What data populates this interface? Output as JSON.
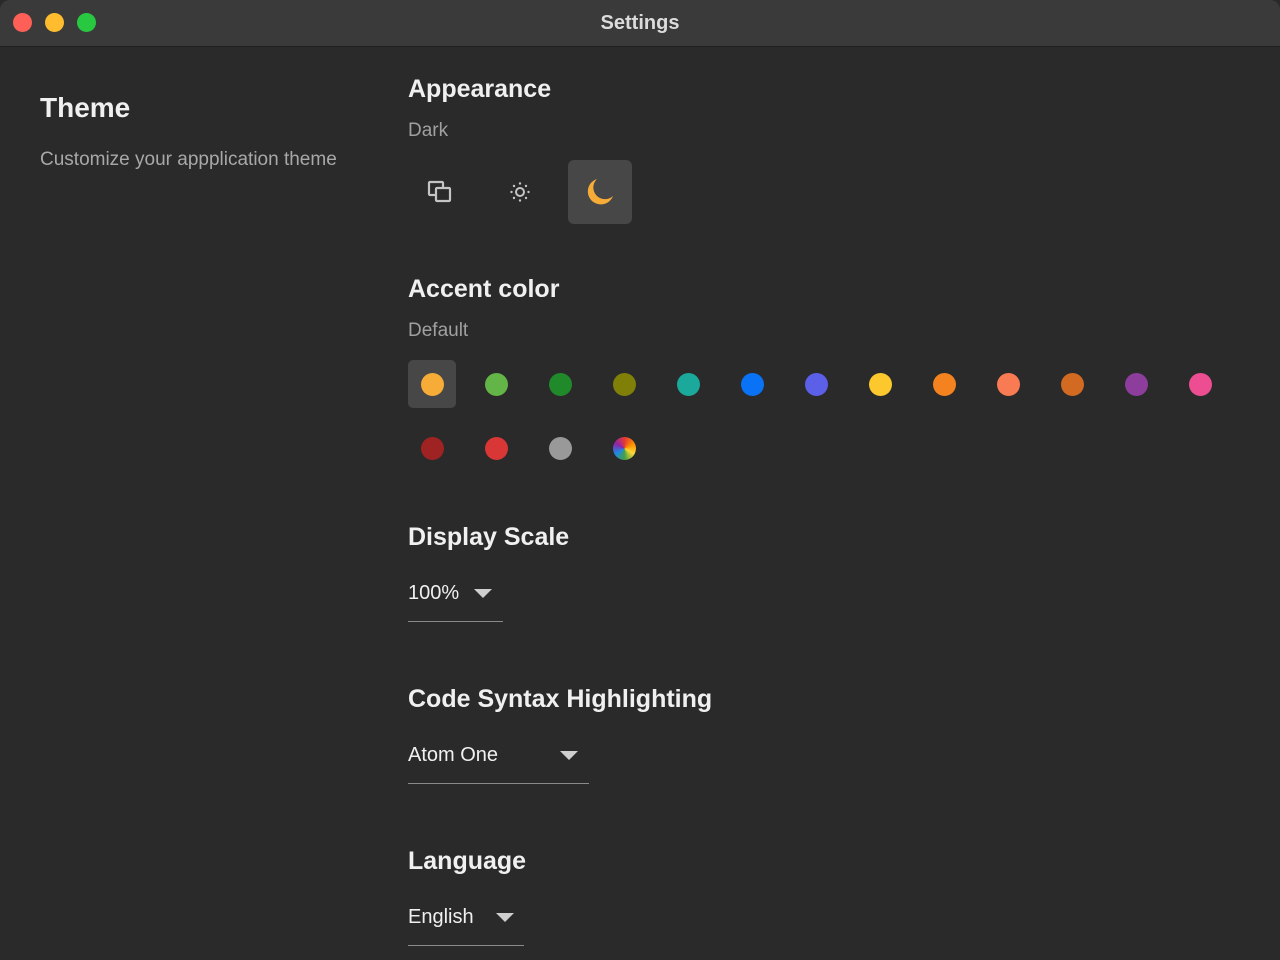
{
  "window": {
    "title": "Settings"
  },
  "sidebar": {
    "title": "Theme",
    "description": "Customize your appplication theme"
  },
  "appearance": {
    "title": "Appearance",
    "current": "Dark",
    "modes": [
      {
        "name": "system",
        "icon": "system-icon",
        "selected": false
      },
      {
        "name": "light",
        "icon": "sun-icon",
        "selected": false
      },
      {
        "name": "dark",
        "icon": "moon-icon",
        "selected": true
      }
    ]
  },
  "accent": {
    "title": "Accent color",
    "current": "Default",
    "colors": [
      "#f7ac37",
      "#62b546",
      "#208a2a",
      "#808009",
      "#1aa99b",
      "#0a72f5",
      "#5c60e8",
      "#fcc82d",
      "#f4821f",
      "#f97b53",
      "#d26b21",
      "#8d3d9c",
      "#ed4e91",
      "#a02323",
      "#d93636",
      "#999999",
      "multicolor"
    ],
    "selected_index": 0
  },
  "display_scale": {
    "title": "Display Scale",
    "value": "100%"
  },
  "syntax": {
    "title": "Code Syntax Highlighting",
    "value": "Atom One"
  },
  "language": {
    "title": "Language",
    "value": "English"
  }
}
